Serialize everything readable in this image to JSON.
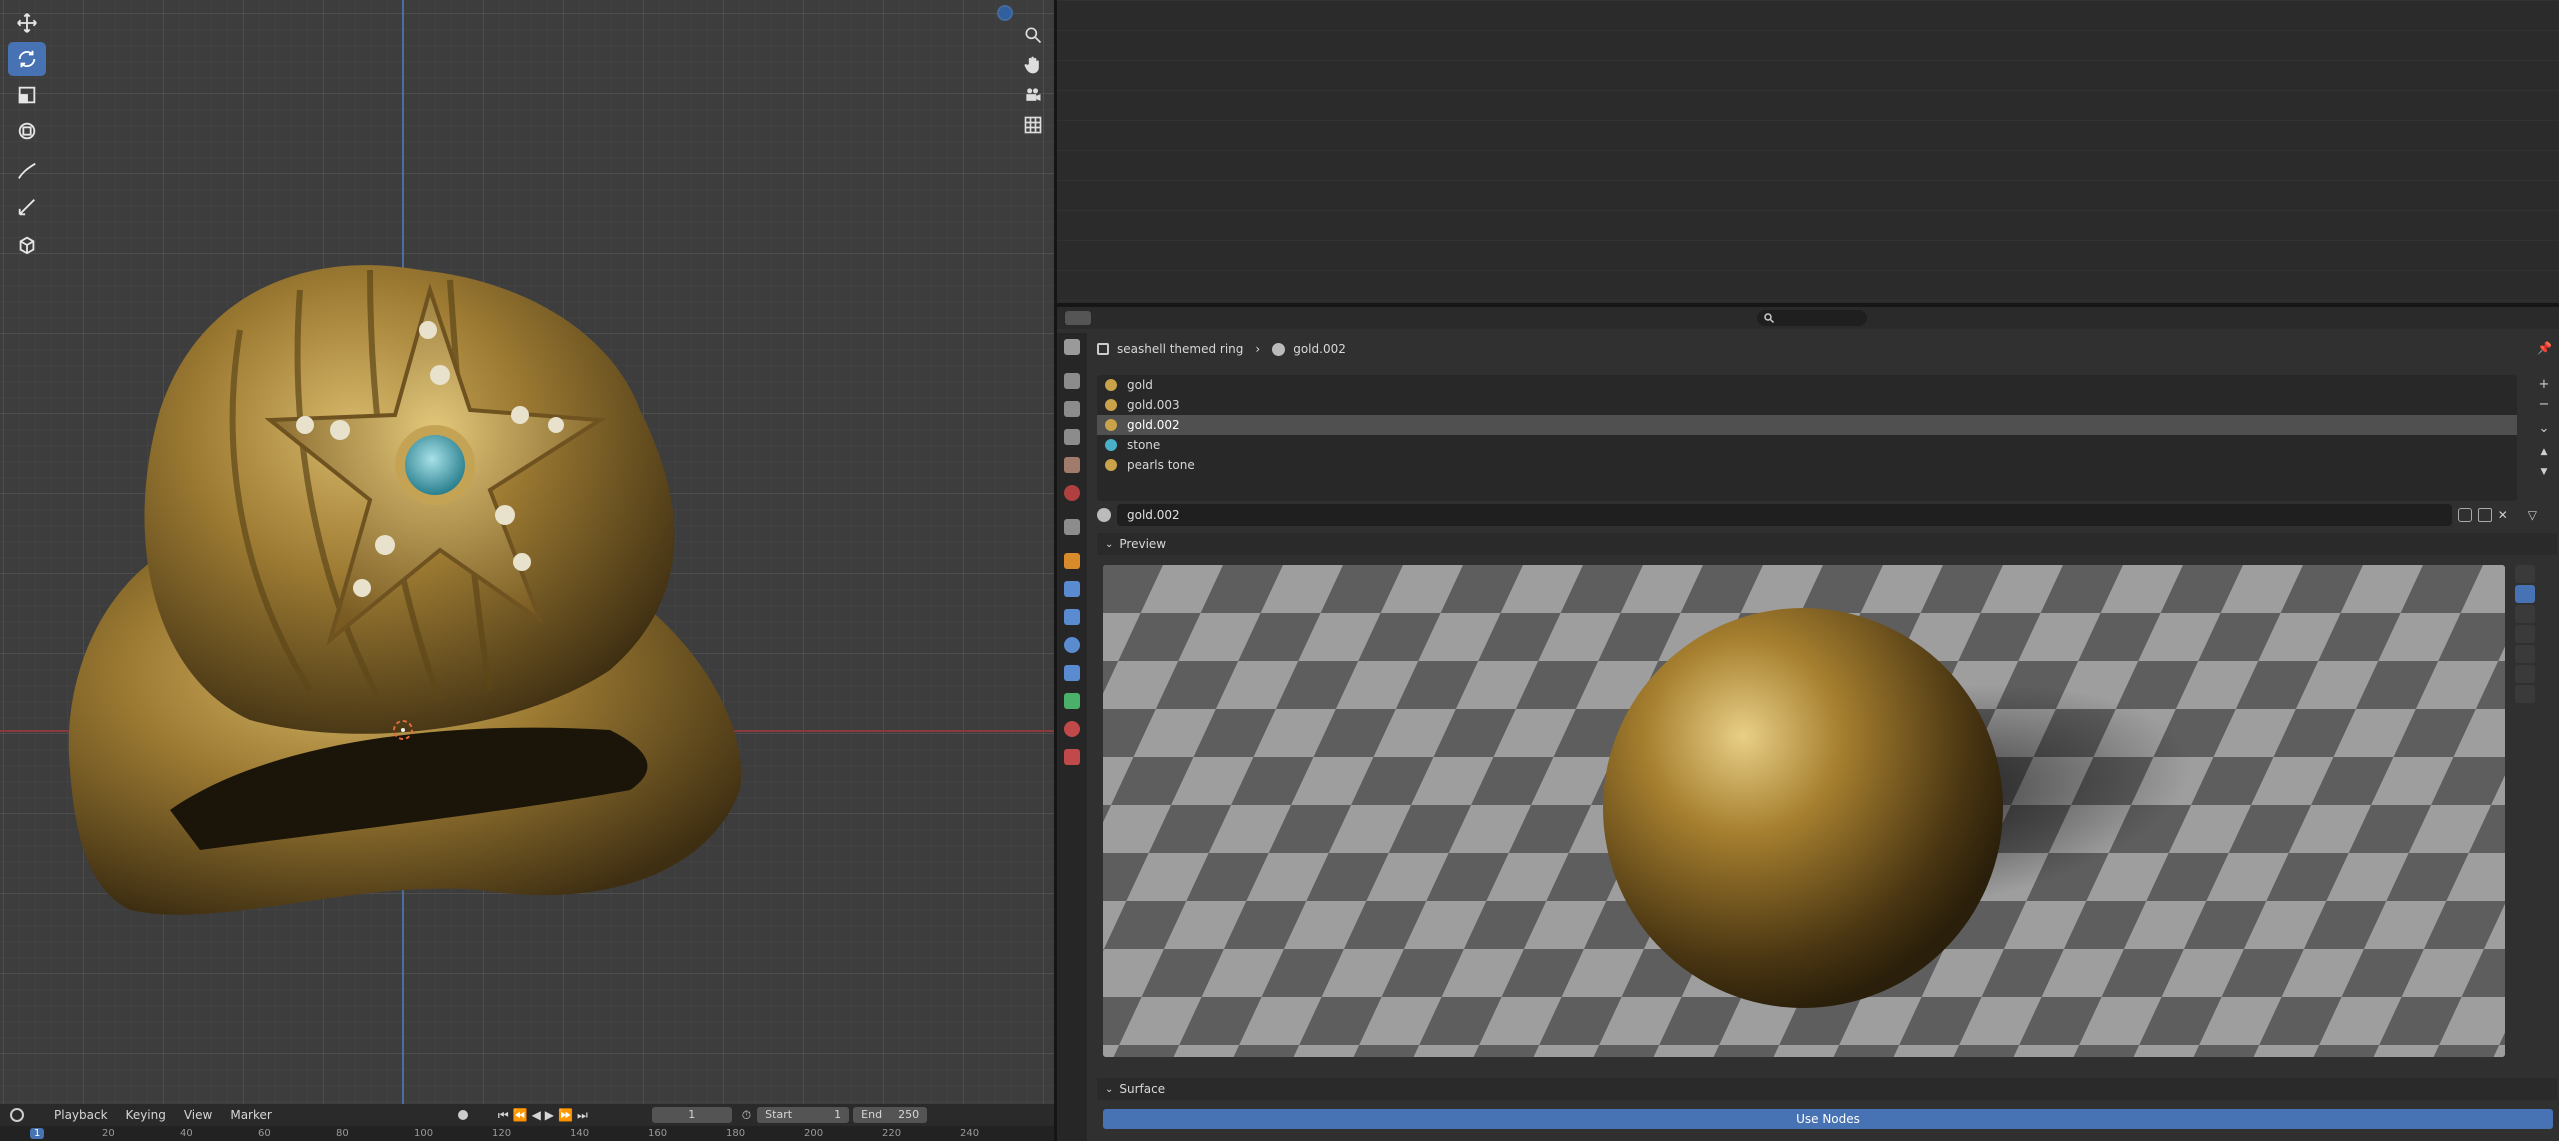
{
  "viewport": {
    "tools": [
      "select-icon",
      "move-icon",
      "rotate-icon",
      "scale-icon",
      "transform-icon",
      "annotate-icon",
      "measure-icon",
      "add-cube-icon"
    ],
    "active_tool": "rotate-icon",
    "nav": [
      "zoom-icon",
      "hand-icon",
      "camera-icon",
      "grid-icon"
    ]
  },
  "properties": {
    "breadcrumb": {
      "object": "seashell themed ring",
      "material": "gold.002"
    },
    "materials": [
      {
        "name": "gold",
        "color": "#c9a24a"
      },
      {
        "name": "gold.003",
        "color": "#c9a24a"
      },
      {
        "name": "gold.002",
        "color": "#c9a24a",
        "selected": true
      },
      {
        "name": "stone",
        "color": "#4ab0c9"
      },
      {
        "name": "pearls tone",
        "color": "#c9a24a"
      }
    ],
    "material_name": "gold.002",
    "preview_label": "Preview",
    "surface_label": "Surface",
    "use_nodes_label": "Use Nodes",
    "list_buttons": [
      "+",
      "−",
      "⌄",
      "▲",
      "▼"
    ]
  },
  "timeline": {
    "menus": [
      "Playback",
      "Keying",
      "View",
      "Marker"
    ],
    "current_frame": "1",
    "start_label": "Start",
    "start_value": "1",
    "end_label": "End",
    "end_value": "250",
    "ruler": [
      "1",
      "20",
      "40",
      "60",
      "80",
      "100",
      "120",
      "140",
      "160",
      "180",
      "200",
      "220",
      "240"
    ]
  },
  "colors": {
    "accent": "#4772b3",
    "gold": "#b08a3a"
  }
}
